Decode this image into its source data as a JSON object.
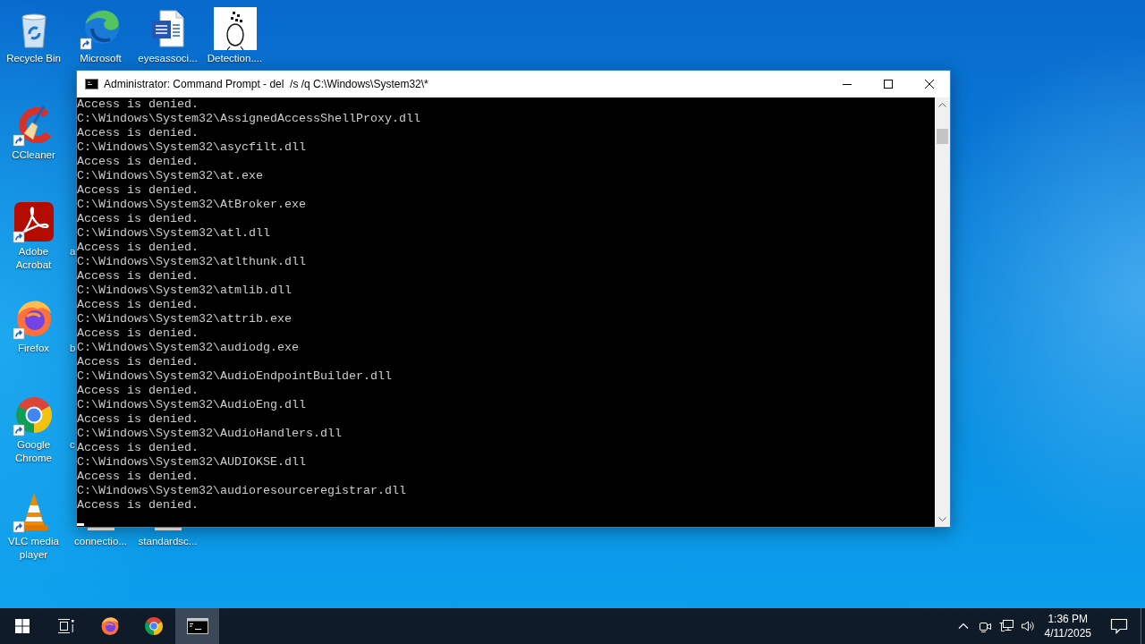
{
  "desktop": {
    "icon_rows": [
      [
        {
          "label": "Recycle Bin",
          "kind": "recycle-bin",
          "shortcut": false
        },
        {
          "label": "Microsoft",
          "kind": "edge",
          "shortcut": true
        },
        {
          "label": "eyesassoci...",
          "kind": "word-doc",
          "shortcut": false
        },
        {
          "label": "Detection....",
          "kind": "sketch",
          "shortcut": false
        }
      ],
      [
        {
          "label": "CCleaner",
          "kind": "ccleaner",
          "shortcut": true
        }
      ],
      [
        {
          "label": "Adobe Acrobat",
          "kind": "acrobat",
          "shortcut": true
        },
        {
          "label": "a",
          "kind": "partial"
        }
      ],
      [
        {
          "label": "Firefox",
          "kind": "firefox",
          "shortcut": true
        },
        {
          "label": "b",
          "kind": "partial"
        }
      ],
      [
        {
          "label": "Google Chrome",
          "kind": "chrome",
          "shortcut": true
        },
        {
          "label": "c",
          "kind": "partial"
        }
      ],
      [
        {
          "label": "VLC media player",
          "kind": "vlc",
          "shortcut": true
        },
        {
          "label": "connectio...",
          "kind": "covered"
        },
        {
          "label": "standardsc...",
          "kind": "covered"
        }
      ]
    ]
  },
  "window": {
    "title": "Administrator: Command Prompt - del  /s /q C:\\Windows\\System32\\*",
    "console_lines": [
      "Access is denied.",
      "C:\\Windows\\System32\\AssignedAccessShellProxy.dll",
      "Access is denied.",
      "C:\\Windows\\System32\\asycfilt.dll",
      "Access is denied.",
      "C:\\Windows\\System32\\at.exe",
      "Access is denied.",
      "C:\\Windows\\System32\\AtBroker.exe",
      "Access is denied.",
      "C:\\Windows\\System32\\atl.dll",
      "Access is denied.",
      "C:\\Windows\\System32\\atlthunk.dll",
      "Access is denied.",
      "C:\\Windows\\System32\\atmlib.dll",
      "Access is denied.",
      "C:\\Windows\\System32\\attrib.exe",
      "Access is denied.",
      "C:\\Windows\\System32\\audiodg.exe",
      "Access is denied.",
      "C:\\Windows\\System32\\AudioEndpointBuilder.dll",
      "Access is denied.",
      "C:\\Windows\\System32\\AudioEng.dll",
      "Access is denied.",
      "C:\\Windows\\System32\\AudioHandlers.dll",
      "Access is denied.",
      "C:\\Windows\\System32\\AUDIOKSE.dll",
      "Access is denied.",
      "C:\\Windows\\System32\\audioresourceregistrar.dll",
      "Access is denied."
    ]
  },
  "taskbar": {
    "buttons": [
      {
        "kind": "start",
        "active": false
      },
      {
        "kind": "task-view",
        "active": false
      },
      {
        "kind": "firefox",
        "active": false
      },
      {
        "kind": "chrome",
        "active": false
      },
      {
        "kind": "console",
        "active": true
      }
    ],
    "tray": {
      "icons": [
        {
          "kind": "chevron"
        },
        {
          "kind": "camera"
        },
        {
          "kind": "network"
        },
        {
          "kind": "volume"
        }
      ],
      "time": "1:36 PM",
      "date": "4/11/2025"
    }
  }
}
